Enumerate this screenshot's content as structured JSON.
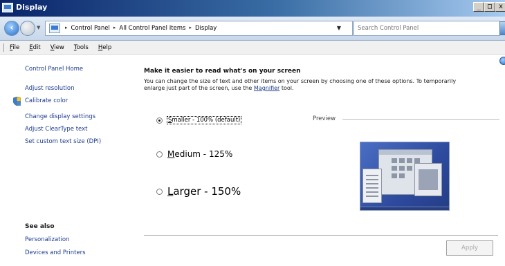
{
  "window": {
    "title": "Display"
  },
  "address": {
    "breadcrumbs": [
      "Control Panel",
      "All Control Panel Items",
      "Display"
    ],
    "search_placeholder": "Search Control Panel"
  },
  "menu": [
    {
      "label": "File",
      "key": "F",
      "rest": "ile"
    },
    {
      "label": "Edit",
      "key": "E",
      "rest": "dit"
    },
    {
      "label": "View",
      "key": "V",
      "rest": "iew"
    },
    {
      "label": "Tools",
      "key": "T",
      "rest": "ools"
    },
    {
      "label": "Help",
      "key": "H",
      "rest": "elp"
    }
  ],
  "sidebar": {
    "home": "Control Panel Home",
    "links": [
      "Adjust resolution",
      "Calibrate color",
      "Change display settings",
      "Adjust ClearType text",
      "Set custom text size (DPI)"
    ],
    "see_also_title": "See also",
    "see_also": [
      "Personalization",
      "Devices and Printers"
    ]
  },
  "main": {
    "heading": "Make it easier to read what's on your screen",
    "desc_line1": "You can change the size of text and other items on your screen by choosing one of these options. To temporarily",
    "desc_line2_pre": "enlarge just part of the screen, use the ",
    "desc_link": "Magnifier",
    "desc_line2_post": " tool.",
    "options": [
      {
        "key": "S",
        "rest": "maller - 100% (default)",
        "checked": true
      },
      {
        "key": "M",
        "rest": "edium - 125%",
        "checked": false
      },
      {
        "key": "L",
        "rest": "arger - 150%",
        "checked": false
      }
    ],
    "preview_label": "Preview",
    "apply_label": "Apply"
  },
  "colors": {
    "link": "#1e3c8c",
    "titlebar": "#0a246a"
  }
}
